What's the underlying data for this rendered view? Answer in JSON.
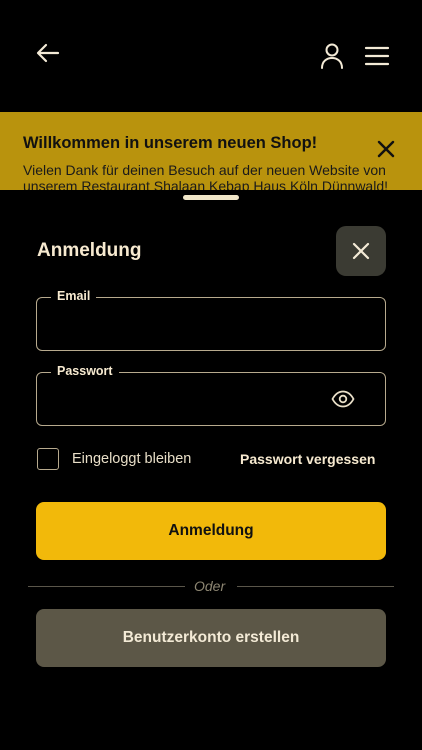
{
  "header": {
    "back_icon": "arrow-left-icon",
    "account_icon": "user-icon",
    "menu_icon": "hamburger-menu-icon"
  },
  "banner": {
    "title": "Willkommen in unserem neuen Shop!",
    "text": "Vielen Dank für deinen Besuch auf der neuen Website von unserem Restaurant Shalaan Kebap Haus Köln Dünnwald!",
    "close_icon": "close-icon",
    "color": "#b9930d"
  },
  "login": {
    "title": "Anmeldung",
    "close_icon": "close-icon",
    "email_label": "Email",
    "email_value": "",
    "password_label": "Passwort",
    "password_value": "",
    "show_password_icon": "eye-icon",
    "remember_label": "Eingeloggt bleiben",
    "remember_checked": false,
    "forgot_label": "Passwort vergessen",
    "submit_label": "Anmeldung",
    "divider_text": "Oder",
    "register_label": "Benutzerkonto erstellen",
    "accent_color": "#f2b90a",
    "secondary_color": "#5c5747"
  }
}
